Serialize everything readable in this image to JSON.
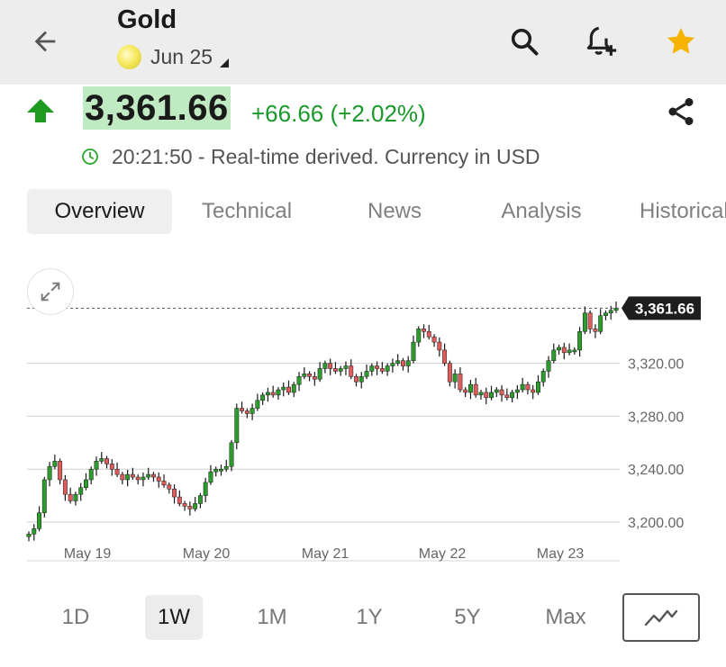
{
  "header": {
    "title": "Gold",
    "contract": "Jun 25",
    "icons": [
      "back-arrow-icon",
      "search-icon",
      "add-alert-icon",
      "star-icon"
    ]
  },
  "quote": {
    "price": "3,361.66",
    "change": "+66.66 (+2.02%)",
    "time_info": "20:21:50 - Real-time derived. Currency in USD"
  },
  "tabs": [
    "Overview",
    "Technical",
    "News",
    "Analysis",
    "Historical"
  ],
  "active_tab": "Overview",
  "ranges": [
    "1D",
    "1W",
    "1M",
    "1Y",
    "5Y",
    "Max"
  ],
  "active_range": "1W",
  "colors": {
    "up": "#2c9c2c",
    "down": "#e05c5c",
    "change_text": "#1a9a2a",
    "price_highlight": "#bfeac2",
    "star": "#f6b400"
  },
  "chart_data": {
    "type": "candlestick",
    "y_ticks": [
      3200,
      3240,
      3280,
      3320
    ],
    "y_tick_labels": [
      "3,200.00",
      "3,240.00",
      "3,280.00",
      "3,320.00"
    ],
    "x_labels": [
      "May 19",
      "May 20",
      "May 21",
      "May 22",
      "May 23"
    ],
    "last_price": 3361.66,
    "last_price_label": "3,361.66",
    "grid": "horizontal",
    "close_series": [
      3191,
      3195,
      3207,
      3232,
      3242,
      3246,
      3232,
      3221,
      3216,
      3221,
      3226,
      3232,
      3240,
      3246,
      3248,
      3244,
      3240,
      3236,
      3232,
      3236,
      3234,
      3232,
      3234,
      3236,
      3234,
      3231,
      3228,
      3225,
      3219,
      3214,
      3212,
      3210,
      3214,
      3220,
      3230,
      3238,
      3240,
      3240,
      3242,
      3260,
      3286,
      3284,
      3282,
      3286,
      3292,
      3296,
      3298,
      3296,
      3300,
      3302,
      3298,
      3304,
      3310,
      3312,
      3310,
      3308,
      3316,
      3320,
      3316,
      3314,
      3316,
      3318,
      3310,
      3306,
      3310,
      3314,
      3318,
      3316,
      3314,
      3318,
      3320,
      3322,
      3318,
      3322,
      3336,
      3346,
      3344,
      3340,
      3336,
      3330,
      3320,
      3306,
      3312,
      3300,
      3298,
      3304,
      3296,
      3298,
      3294,
      3298,
      3300,
      3296,
      3294,
      3298,
      3300,
      3304,
      3300,
      3298,
      3306,
      3314,
      3322,
      3330,
      3332,
      3328,
      3330,
      3330,
      3344,
      3358,
      3346,
      3344,
      3356,
      3358,
      3360,
      3361.66
    ]
  }
}
